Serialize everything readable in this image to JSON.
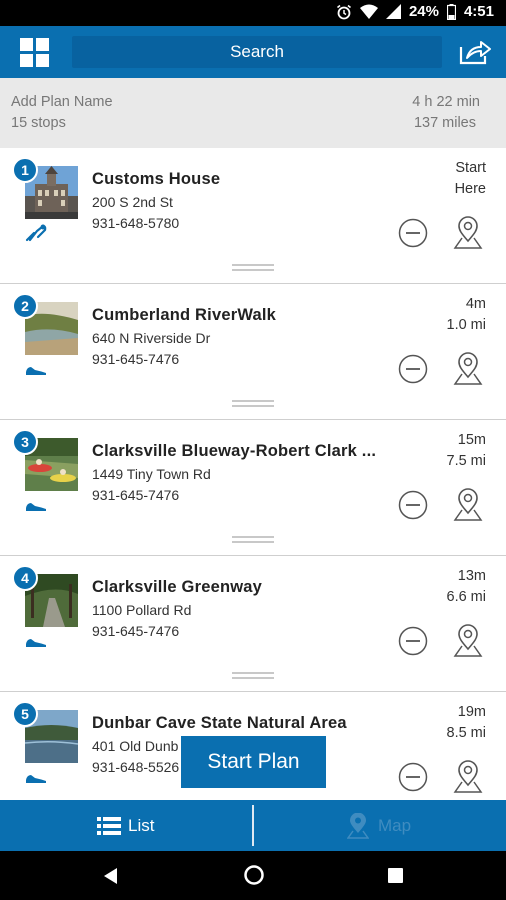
{
  "status_bar": {
    "battery": "24%",
    "time": "4:51"
  },
  "header": {
    "search_label": "Search"
  },
  "plan": {
    "name_placeholder": "Add Plan Name",
    "stops_count": "15 stops",
    "duration": "4 h 22 min",
    "distance": "137 miles"
  },
  "stops": [
    {
      "number": "1",
      "name": "Customs House",
      "address": "200 S 2nd St",
      "phone": "931-648-5780",
      "time": "Start",
      "distance": "Here",
      "mode_icon": "bike-icon"
    },
    {
      "number": "2",
      "name": "Cumberland RiverWalk",
      "address": "640 N Riverside Dr",
      "phone": "931-645-7476",
      "time": "4m",
      "distance": "1.0 mi",
      "mode_icon": "shoe-icon"
    },
    {
      "number": "3",
      "name": "Clarksville Blueway-Robert Clark ...",
      "address": "1449 Tiny Town Rd",
      "phone": "931-645-7476",
      "time": "15m",
      "distance": "7.5 mi",
      "mode_icon": "shoe-icon"
    },
    {
      "number": "4",
      "name": "Clarksville Greenway",
      "address": "1100 Pollard Rd",
      "phone": "931-645-7476",
      "time": "13m",
      "distance": "6.6 mi",
      "mode_icon": "shoe-icon"
    },
    {
      "number": "5",
      "name": "Dunbar Cave State Natural Area",
      "address": "401 Old Dunb",
      "phone": "931-648-5526",
      "time": "19m",
      "distance": "8.5 mi",
      "mode_icon": "shoe-icon"
    }
  ],
  "start_plan_label": "Start Plan",
  "tabs": {
    "list_label": "List",
    "map_label": "Map"
  },
  "colors": {
    "primary": "#0a6fb0",
    "summary_bg": "#e9e9e9"
  }
}
